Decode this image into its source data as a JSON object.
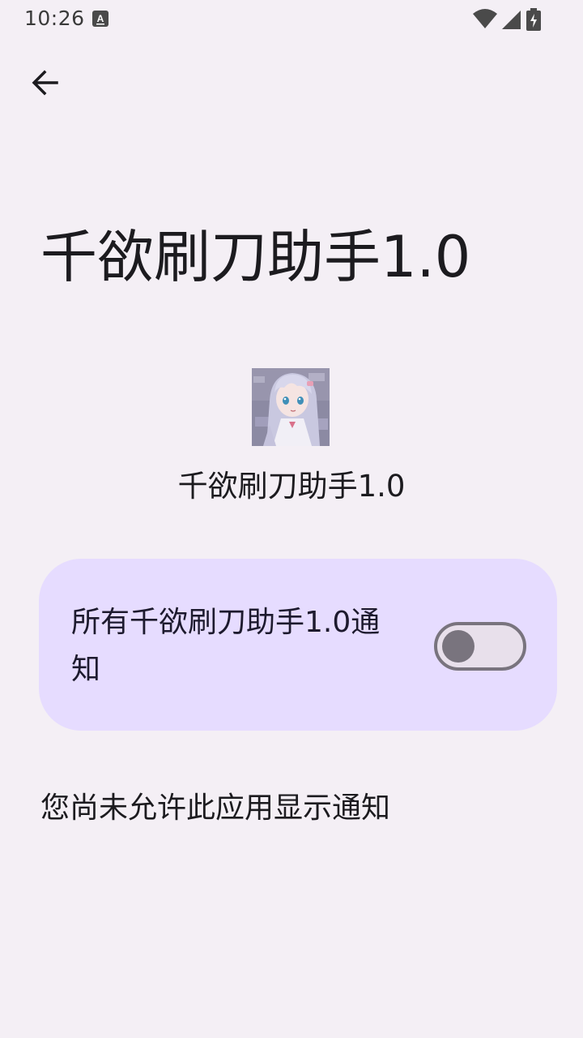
{
  "status_bar": {
    "time": "10:26",
    "left_icon": "keyboard-a-icon",
    "right_icons": [
      "wifi-icon",
      "cell-signal-icon",
      "battery-charging-icon"
    ]
  },
  "toolbar": {
    "back_icon": "arrow-back-icon"
  },
  "page": {
    "title": "千欲刷刀助手1.0"
  },
  "app": {
    "name": "千欲刷刀助手1.0",
    "icon": "app-icon-anime-character"
  },
  "notification_setting": {
    "label": "所有千欲刷刀助手1.0通知",
    "enabled": false
  },
  "notice": {
    "text": "您尚未允许此应用显示通知"
  },
  "colors": {
    "background": "#f4eff5",
    "card": "#e6dcff",
    "toggle_outline": "#79747e"
  }
}
